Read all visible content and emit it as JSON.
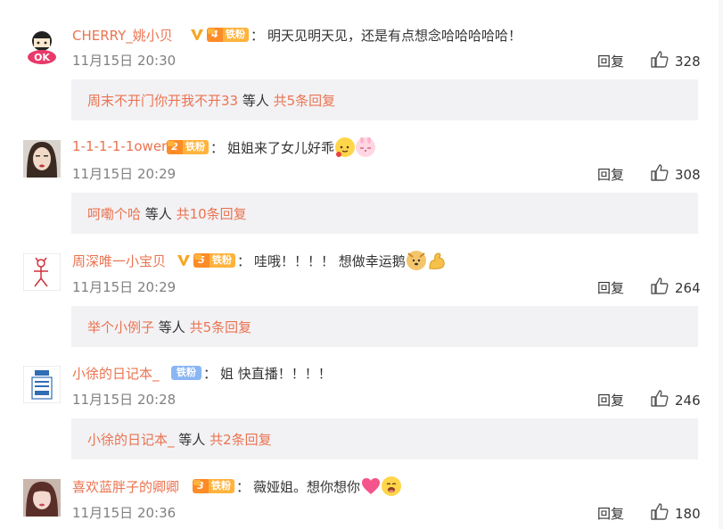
{
  "comments": [
    {
      "username": "CHERRY_姚小贝",
      "fan_level": "4",
      "fan_label": "铁粉",
      "content": "明天见明天见，还是有点想念哈哈哈哈哈！",
      "time": "11月15日 20:30",
      "reply_label": "回复",
      "likes": "328",
      "sub": {
        "username": "周末不开门你开我不开33",
        "mid": " 等人 ",
        "total": "共5条回复"
      }
    },
    {
      "username": "1-1-1-1-1ower",
      "fan_level": "2",
      "fan_label": "铁粉",
      "content": "姐姐来了女儿好乖",
      "time": "11月15日 20:29",
      "reply_label": "回复",
      "likes": "308",
      "sub": {
        "username": "呵嘞个哈",
        "mid": " 等人 ",
        "total": "共10条回复"
      }
    },
    {
      "username": "周深唯一小宝贝",
      "fan_level": "5",
      "fan_label": "铁粉",
      "content": "哇哦！！！！ 想做幸运鹅",
      "time": "11月15日 20:29",
      "reply_label": "回复",
      "likes": "264",
      "sub": {
        "username": "举个小例子",
        "mid": " 等人 ",
        "total": "共5条回复"
      }
    },
    {
      "username": "小徐的日记本_",
      "fan_label": "铁粉",
      "content": "姐 快直播！！！！",
      "time": "11月15日 20:28",
      "reply_label": "回复",
      "likes": "246",
      "sub": {
        "username": "小徐的日记本_",
        "mid": " 等人 ",
        "total": "共2条回复"
      }
    },
    {
      "username": "喜欢蓝胖子的卿卿",
      "fan_level": "3",
      "fan_label": "铁粉",
      "content": "薇娅姐。想你想你",
      "time": "11月15日 20:36",
      "reply_label": "回复",
      "likes": "180"
    }
  ],
  "colors": {
    "username": "#eb7350",
    "sub_background": "#f2f2f5",
    "time": "#808080",
    "vip": "#f5a623",
    "fan_badge": "#ffb33d"
  },
  "icons": {
    "like": "thumbs-up-icon",
    "vip": "vip-v-icon"
  }
}
